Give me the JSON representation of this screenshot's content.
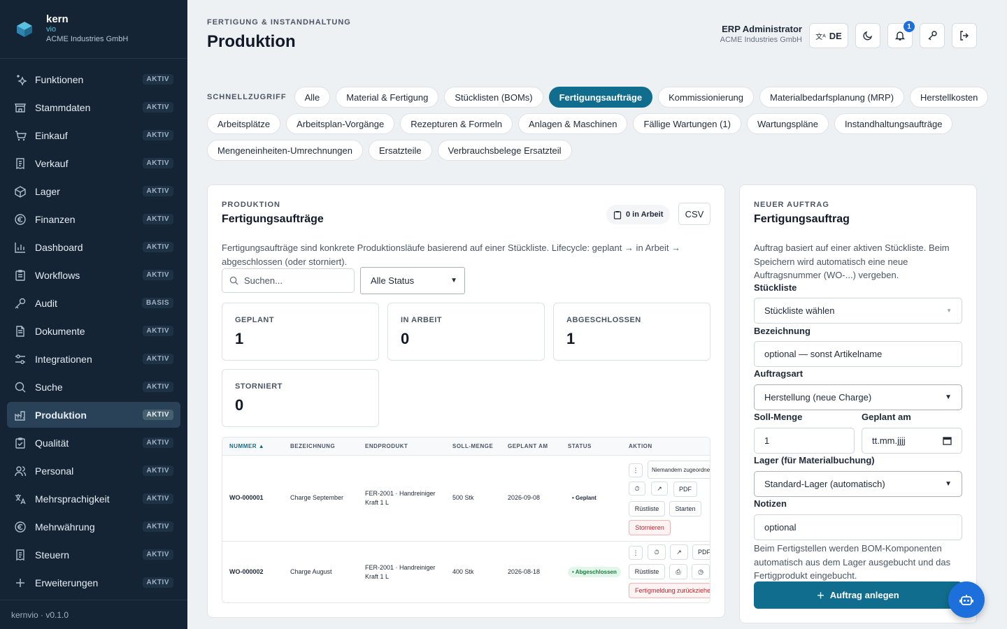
{
  "brand": {
    "name": "kern",
    "sub": "vio",
    "company": "ACME Industries GmbH"
  },
  "sidebar": {
    "items": [
      {
        "label": "Funktionen",
        "badge": "AKTIV",
        "icon": "sparkles-icon"
      },
      {
        "label": "Stammdaten",
        "badge": "AKTIV",
        "icon": "store-icon"
      },
      {
        "label": "Einkauf",
        "badge": "AKTIV",
        "icon": "cart-icon"
      },
      {
        "label": "Verkauf",
        "badge": "AKTIV",
        "icon": "receipt-icon"
      },
      {
        "label": "Lager",
        "badge": "AKTIV",
        "icon": "box-icon"
      },
      {
        "label": "Finanzen",
        "badge": "AKTIV",
        "icon": "euro-icon"
      },
      {
        "label": "Dashboard",
        "badge": "AKTIV",
        "icon": "bar-chart-icon"
      },
      {
        "label": "Workflows",
        "badge": "AKTIV",
        "icon": "clipboard-icon"
      },
      {
        "label": "Audit",
        "badge": "BASIS",
        "icon": "key-icon"
      },
      {
        "label": "Dokumente",
        "badge": "AKTIV",
        "icon": "document-icon"
      },
      {
        "label": "Integrationen",
        "badge": "AKTIV",
        "icon": "sliders-icon"
      },
      {
        "label": "Suche",
        "badge": "AKTIV",
        "icon": "search-icon"
      },
      {
        "label": "Produktion",
        "badge": "AKTIV",
        "icon": "factory-icon"
      },
      {
        "label": "Qualität",
        "badge": "AKTIV",
        "icon": "clipboard-check-icon"
      },
      {
        "label": "Personal",
        "badge": "AKTIV",
        "icon": "users-icon"
      },
      {
        "label": "Mehrsprachigkeit",
        "badge": "AKTIV",
        "icon": "translate-icon"
      },
      {
        "label": "Mehrwährung",
        "badge": "AKTIV",
        "icon": "euro-icon"
      },
      {
        "label": "Steuern",
        "badge": "AKTIV",
        "icon": "receipt-icon"
      },
      {
        "label": "Erweiterungen",
        "badge": "AKTIV",
        "icon": "plus-icon"
      }
    ],
    "footer": "kernvio · v0.1.0"
  },
  "header": {
    "eyebrow": "FERTIGUNG & INSTANDHALTUNG",
    "title": "Produktion",
    "user_name": "ERP Administrator",
    "user_company": "ACME Industries GmbH",
    "lang": "DE",
    "notifications": "1"
  },
  "quick": {
    "label": "SCHNELLZUGRIFF",
    "row1": [
      "Alle",
      "Material & Fertigung",
      "Stücklisten (BOMs)",
      "Fertigungsaufträge",
      "Kommissionierung",
      "Materialbedarfsplanung (MRP)",
      "Herstellkosten"
    ],
    "row2": [
      "Arbeitsplätze",
      "Arbeitsplan-Vorgänge",
      "Rezepturen & Formeln",
      "Anlagen & Maschinen",
      "Fällige Wartungen (1)",
      "Wartungspläne",
      "Instandhaltungsaufträge"
    ],
    "row3": [
      "Mengeneinheiten-Umrechnungen",
      "Ersatzteile",
      "Verbrauchsbelege Ersatzteil"
    ]
  },
  "orders": {
    "eyebrow": "PRODUKTION",
    "title": "Fertigungsaufträge",
    "in_work": "0 in Arbeit",
    "csv": "CSV",
    "description": "Fertigungsaufträge sind konkrete Produktionsläufe basierend auf einer Stückliste. Lifecycle: geplant → in Arbeit → abgeschlossen (oder storniert).",
    "search_placeholder": "Suchen...",
    "status_filter": "Alle Status",
    "stats": [
      {
        "label": "GEPLANT",
        "value": "1"
      },
      {
        "label": "IN ARBEIT",
        "value": "0"
      },
      {
        "label": "ABGESCHLOSSEN",
        "value": "1"
      },
      {
        "label": "STORNIERT",
        "value": "0"
      }
    ],
    "columns": [
      "NUMMER ▲",
      "BEZEICHNUNG",
      "ENDPRODUKT",
      "SOLL-MENGE",
      "GEPLANT AM",
      "STATUS",
      "AKTION"
    ],
    "rows": [
      {
        "number": "WO-000001",
        "name": "Charge September",
        "product": "FER-2001 · Handreiniger Kraft 1 L",
        "qty": "500 Stk",
        "date": "2026-09-08",
        "status": "• Geplant",
        "assign": "Niemandem zugeordnet",
        "pdf": "PDF",
        "pick": "Rüstliste",
        "start": "Starten",
        "cancel": "Stornieren"
      },
      {
        "number": "WO-000002",
        "name": "Charge August",
        "product": "FER-2001 · Handreiniger Kraft 1 L",
        "qty": "400 Stk",
        "date": "2026-08-18",
        "status": "• Abgeschlossen",
        "pdf": "PDF",
        "pick": "Rüstliste",
        "revert": "Fertigmeldung zurückziehen"
      }
    ]
  },
  "new_order": {
    "eyebrow": "NEUER AUFTRAG",
    "title": "Fertigungsauftrag",
    "description": "Auftrag basiert auf einer aktiven Stückliste. Beim Speichern wird automatisch eine neue Auftragsnummer (WO-...) vergeben.",
    "bom_label": "Stückliste",
    "bom_value": "Stückliste wählen",
    "name_label": "Bezeichnung",
    "name_placeholder": "optional — sonst Artikelname",
    "type_label": "Auftragsart",
    "type_value": "Herstellung (neue Charge)",
    "qty_label": "Soll-Menge",
    "qty_value": "1",
    "date_label": "Geplant am",
    "date_value": "tt.mm.jjjj",
    "storage_label": "Lager (für Materialbuchung)",
    "storage_value": "Standard-Lager (automatisch)",
    "notes_label": "Notizen",
    "notes_placeholder": "optional",
    "hint": "Beim Fertigstellen werden BOM-Komponenten automatisch aus dem Lager ausgebucht und das Fertigprodukt eingebucht.",
    "submit": "Auftrag anlegen"
  },
  "colors": {
    "accent": "#116d8d",
    "sidebar": "#142434",
    "danger": "#c0262d",
    "fab": "#1d6fdc"
  }
}
